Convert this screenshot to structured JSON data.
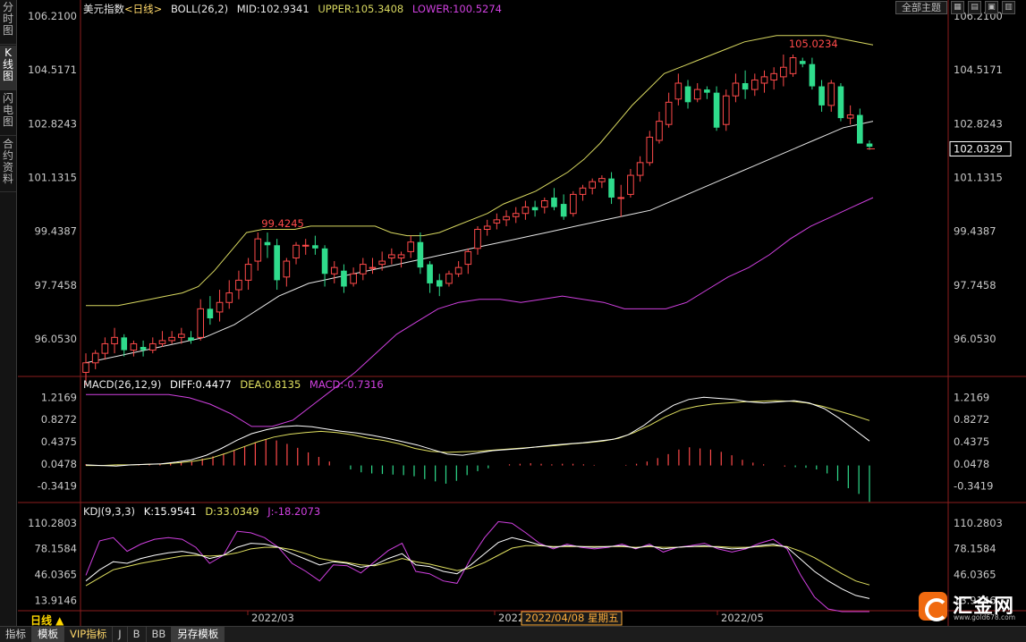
{
  "left_tabs": [
    "分时图",
    "K线图",
    "闪电图",
    "合约资料"
  ],
  "header": {
    "boll": {
      "name": "美元指数",
      "period": "<日线>",
      "params": "BOLL(26,2)",
      "mid": "MID:102.9341",
      "upper": "UPPER:105.3408",
      "lower": "LOWER:100.5274"
    },
    "theme_button": "全部主题",
    "window_buttons": [
      "▦",
      "▤",
      "▣",
      "▥"
    ]
  },
  "price_axis": {
    "ticks": [
      "106.2100",
      "104.5171",
      "102.8243",
      "101.1315",
      "99.4387",
      "97.7458",
      "96.0530"
    ],
    "current_price": "102.0329"
  },
  "annotations": {
    "high_label": "105.0234",
    "low_label": "99.4245"
  },
  "macd": {
    "title": "MACD(26,12,9)",
    "diff": "DIFF:0.4477",
    "dea": "DEA:0.8135",
    "macd": "MACD:-0.7316",
    "ticks": [
      "1.2169",
      "0.8272",
      "0.4375",
      "0.0478",
      "-0.3419"
    ]
  },
  "kdj": {
    "title": "KDJ(9,3,3)",
    "k": "K:15.9541",
    "d": "D:33.0349",
    "j": "J:-18.2073",
    "ticks": [
      "110.2803",
      "78.1584",
      "46.0365",
      "13.9146"
    ]
  },
  "date_axis": {
    "labels": [
      "2022/03",
      "2022/04",
      "2022/05"
    ],
    "cursor_date": "2022/04/08 星期五"
  },
  "period_label": "日线 ▲",
  "bottom_tabs": [
    "指标",
    "模板",
    "VIP指标",
    "J",
    "B",
    "BB",
    "另存模板"
  ],
  "bottom_tab_active": "模板",
  "logo": {
    "text": "汇金网",
    "url": "www.gold678.com"
  },
  "colors": {
    "up": "#ff4a4a",
    "down": "#2fdc8c",
    "mid": "#e6e6e6",
    "upper": "#d8d860",
    "lower": "#d040e0",
    "axis": "#8c1e1e",
    "diff": "#ffffff",
    "dea": "#e0e060",
    "k": "#ffffff",
    "d": "#e0e060",
    "j": "#d040e0"
  },
  "chart_data": {
    "type": "candlestick",
    "price_range": [
      94.9,
      106.21
    ],
    "candles": [
      [
        95.0,
        95.6,
        94.6,
        95.3
      ],
      [
        95.3,
        95.7,
        95.1,
        95.6
      ],
      [
        95.6,
        96.1,
        95.4,
        95.9
      ],
      [
        95.9,
        96.4,
        95.6,
        96.1
      ],
      [
        96.1,
        96.2,
        95.5,
        95.7
      ],
      [
        95.7,
        96.0,
        95.5,
        95.9
      ],
      [
        95.8,
        96.0,
        95.5,
        95.7
      ],
      [
        95.7,
        96.1,
        95.6,
        95.9
      ],
      [
        95.9,
        96.3,
        95.8,
        96.0
      ],
      [
        96.0,
        96.3,
        95.9,
        96.1
      ],
      [
        96.1,
        96.4,
        95.9,
        96.2
      ],
      [
        96.1,
        96.3,
        95.9,
        96.0
      ],
      [
        96.1,
        97.3,
        96.0,
        97.0
      ],
      [
        97.0,
        97.4,
        96.5,
        96.7
      ],
      [
        96.9,
        97.6,
        96.6,
        97.2
      ],
      [
        97.2,
        97.9,
        97.0,
        97.5
      ],
      [
        97.6,
        98.2,
        97.3,
        97.9
      ],
      [
        97.9,
        98.6,
        97.6,
        98.4
      ],
      [
        98.5,
        99.4,
        98.2,
        99.2
      ],
      [
        99.1,
        99.4,
        98.6,
        99.0
      ],
      [
        99.0,
        99.2,
        97.6,
        97.9
      ],
      [
        98.0,
        98.6,
        97.7,
        98.5
      ],
      [
        98.6,
        99.1,
        98.4,
        99.0
      ],
      [
        99.0,
        99.2,
        98.7,
        99.0
      ],
      [
        99.0,
        99.3,
        98.7,
        98.9
      ],
      [
        98.9,
        99.0,
        97.7,
        98.1
      ],
      [
        98.1,
        98.5,
        97.8,
        98.3
      ],
      [
        98.2,
        98.4,
        97.5,
        97.7
      ],
      [
        97.8,
        98.3,
        97.7,
        98.1
      ],
      [
        98.1,
        98.6,
        97.9,
        98.4
      ],
      [
        98.3,
        98.6,
        98.1,
        98.3
      ],
      [
        98.4,
        98.8,
        98.2,
        98.5
      ],
      [
        98.6,
        98.9,
        98.4,
        98.7
      ],
      [
        98.6,
        98.8,
        98.3,
        98.7
      ],
      [
        98.8,
        99.3,
        98.6,
        99.1
      ],
      [
        99.1,
        99.4,
        98.1,
        98.3
      ],
      [
        98.4,
        98.5,
        97.5,
        97.8
      ],
      [
        97.9,
        98.1,
        97.4,
        97.7
      ],
      [
        97.8,
        98.2,
        97.7,
        98.1
      ],
      [
        98.1,
        98.5,
        98.0,
        98.3
      ],
      [
        98.4,
        98.9,
        98.1,
        98.8
      ],
      [
        98.9,
        99.6,
        98.7,
        99.5
      ],
      [
        99.5,
        99.8,
        99.3,
        99.6
      ],
      [
        99.7,
        100.0,
        99.5,
        99.8
      ],
      [
        99.8,
        100.1,
        99.6,
        99.9
      ],
      [
        99.9,
        100.2,
        99.7,
        100.0
      ],
      [
        100.0,
        100.4,
        99.8,
        100.2
      ],
      [
        100.2,
        100.4,
        99.9,
        100.1
      ],
      [
        100.2,
        100.5,
        100.0,
        100.4
      ],
      [
        100.5,
        100.8,
        100.1,
        100.2
      ],
      [
        100.3,
        100.6,
        99.8,
        99.9
      ],
      [
        100.0,
        100.7,
        99.9,
        100.6
      ],
      [
        100.6,
        100.9,
        100.4,
        100.8
      ],
      [
        100.8,
        101.1,
        100.6,
        101.0
      ],
      [
        101.0,
        101.2,
        100.8,
        101.1
      ],
      [
        101.1,
        101.3,
        100.3,
        100.5
      ],
      [
        100.5,
        100.9,
        99.9,
        100.5
      ],
      [
        100.6,
        101.4,
        100.5,
        101.2
      ],
      [
        101.2,
        101.8,
        101.0,
        101.6
      ],
      [
        101.6,
        102.6,
        101.5,
        102.4
      ],
      [
        102.3,
        103.2,
        102.2,
        102.9
      ],
      [
        102.8,
        103.8,
        102.7,
        103.5
      ],
      [
        103.6,
        104.4,
        103.4,
        104.1
      ],
      [
        104.0,
        104.2,
        103.3,
        103.5
      ],
      [
        103.6,
        104.1,
        103.5,
        103.9
      ],
      [
        103.9,
        104.0,
        103.6,
        103.8
      ],
      [
        103.8,
        104.0,
        102.6,
        102.7
      ],
      [
        102.8,
        103.9,
        102.6,
        103.7
      ],
      [
        103.7,
        104.4,
        103.5,
        104.1
      ],
      [
        104.1,
        104.5,
        103.6,
        103.9
      ],
      [
        103.9,
        104.4,
        103.7,
        104.2
      ],
      [
        104.1,
        104.5,
        103.8,
        104.3
      ],
      [
        104.2,
        104.6,
        103.9,
        104.4
      ],
      [
        104.3,
        105.0,
        104.0,
        104.6
      ],
      [
        104.4,
        105.0,
        104.3,
        104.9
      ],
      [
        104.8,
        104.9,
        104.6,
        104.7
      ],
      [
        104.7,
        104.9,
        103.9,
        104.0
      ],
      [
        104.0,
        104.2,
        103.2,
        103.4
      ],
      [
        103.4,
        104.2,
        103.2,
        104.1
      ],
      [
        104.0,
        104.1,
        102.9,
        103.0
      ],
      [
        103.0,
        103.4,
        102.8,
        103.1
      ],
      [
        103.1,
        103.3,
        102.2,
        102.2
      ],
      [
        102.2,
        102.3,
        102.0,
        102.1
      ]
    ],
    "mid": [
      95.3,
      95.4,
      95.5,
      95.6,
      95.7,
      95.8,
      95.9,
      96.0,
      96.1,
      96.3,
      96.5,
      96.8,
      97.1,
      97.4,
      97.6,
      97.8,
      97.9,
      98.0,
      98.1,
      98.2,
      98.3,
      98.4,
      98.5,
      98.6,
      98.7,
      98.8,
      98.9,
      99.0,
      99.1,
      99.2,
      99.3,
      99.4,
      99.5,
      99.6,
      99.7,
      99.8,
      99.9,
      100.0,
      100.1,
      100.3,
      100.5,
      100.7,
      100.9,
      101.1,
      101.3,
      101.5,
      101.7,
      101.9,
      102.1,
      102.3,
      102.5,
      102.7,
      102.8,
      102.9
    ],
    "upper": [
      97.1,
      97.1,
      97.1,
      97.2,
      97.3,
      97.4,
      97.5,
      97.7,
      98.2,
      98.8,
      99.4,
      99.5,
      99.5,
      99.5,
      99.6,
      99.6,
      99.6,
      99.6,
      99.6,
      99.4,
      99.3,
      99.3,
      99.4,
      99.6,
      99.8,
      100.0,
      100.3,
      100.5,
      100.7,
      101.0,
      101.3,
      101.7,
      102.2,
      102.8,
      103.4,
      103.9,
      104.4,
      104.6,
      104.8,
      105.0,
      105.2,
      105.4,
      105.5,
      105.6,
      105.6,
      105.6,
      105.6,
      105.5,
      105.4,
      105.3
    ],
    "lower": [
      94.3,
      94.3,
      94.3,
      94.3,
      94.3,
      94.2,
      94.0,
      93.7,
      93.3,
      93.3,
      93.5,
      94.0,
      94.5,
      95.0,
      95.6,
      96.2,
      96.6,
      97.0,
      97.2,
      97.3,
      97.3,
      97.2,
      97.3,
      97.4,
      97.3,
      97.2,
      97.0,
      97.0,
      97.0,
      97.2,
      97.6,
      98.0,
      98.3,
      98.7,
      99.2,
      99.6,
      99.9,
      100.2,
      100.5
    ],
    "macd_range": [
      -0.6,
      1.35
    ],
    "macd_bars": [
      0.04,
      0.03,
      0.02,
      0.03,
      0.02,
      0.03,
      0.04,
      0.05,
      0.06,
      0.08,
      0.1,
      0.14,
      0.18,
      0.23,
      0.29,
      0.36,
      0.43,
      0.48,
      0.46,
      0.4,
      0.33,
      0.25,
      0.17,
      0.09,
      0.02,
      -0.05,
      -0.1,
      -0.12,
      -0.13,
      -0.14,
      -0.15,
      -0.17,
      -0.22,
      -0.26,
      -0.3,
      -0.25,
      -0.15,
      -0.08,
      -0.03,
      0.02,
      0.04,
      0.05,
      0.06,
      0.05,
      0.04,
      0.05,
      0.05,
      0.04,
      0.03,
      0.02,
      0.02,
      0.03,
      0.05,
      0.09,
      0.15,
      0.22,
      0.3,
      0.34,
      0.32,
      0.3,
      0.26,
      0.2,
      0.12,
      0.07,
      0.04,
      0.02,
      0.0,
      -0.01,
      -0.02,
      -0.05,
      -0.12,
      -0.25,
      -0.38,
      -0.48,
      -0.62
    ],
    "diff": [
      0.03,
      0.02,
      0.01,
      0.03,
      0.04,
      0.05,
      0.08,
      0.12,
      0.2,
      0.32,
      0.46,
      0.58,
      0.65,
      0.7,
      0.72,
      0.7,
      0.66,
      0.62,
      0.59,
      0.55,
      0.5,
      0.44,
      0.38,
      0.3,
      0.22,
      0.2,
      0.24,
      0.28,
      0.3,
      0.32,
      0.35,
      0.38,
      0.4,
      0.42,
      0.45,
      0.48,
      0.56,
      0.72,
      0.92,
      1.08,
      1.18,
      1.22,
      1.2,
      1.18,
      1.14,
      1.12,
      1.14,
      1.16,
      1.12,
      1.02,
      0.85,
      0.65,
      0.45
    ],
    "dea": [
      0.02,
      0.02,
      0.03,
      0.03,
      0.04,
      0.05,
      0.07,
      0.1,
      0.15,
      0.24,
      0.34,
      0.44,
      0.52,
      0.57,
      0.6,
      0.62,
      0.6,
      0.56,
      0.5,
      0.46,
      0.4,
      0.32,
      0.27,
      0.25,
      0.26,
      0.27,
      0.29,
      0.31,
      0.33,
      0.35,
      0.37,
      0.4,
      0.42,
      0.45,
      0.5,
      0.6,
      0.73,
      0.88,
      1.0,
      1.06,
      1.1,
      1.12,
      1.14,
      1.15,
      1.16,
      1.15,
      1.12,
      1.06,
      0.98,
      0.9,
      0.81
    ],
    "kdj_range": [
      2,
      118
    ],
    "k": [
      38,
      52,
      62,
      60,
      66,
      70,
      73,
      75,
      72,
      66,
      70,
      80,
      85,
      84,
      80,
      72,
      65,
      58,
      62,
      60,
      55,
      58,
      66,
      72,
      58,
      56,
      50,
      47,
      58,
      72,
      86,
      92,
      88,
      83,
      80,
      82,
      81,
      80,
      81,
      82,
      79,
      82,
      78,
      80,
      81,
      82,
      80,
      78,
      79,
      82,
      84,
      80,
      65,
      50,
      38,
      28,
      20,
      16
    ],
    "d": [
      32,
      42,
      52,
      56,
      60,
      63,
      66,
      69,
      70,
      69,
      70,
      73,
      78,
      80,
      80,
      77,
      72,
      66,
      63,
      61,
      58,
      57,
      61,
      66,
      62,
      59,
      55,
      51,
      54,
      61,
      70,
      79,
      82,
      82,
      81,
      81,
      81,
      81,
      81,
      81,
      80,
      81,
      80,
      80,
      81,
      81,
      81,
      80,
      80,
      81,
      82,
      81,
      75,
      67,
      57,
      47,
      38,
      33
    ],
    "j": [
      45,
      88,
      92,
      75,
      84,
      90,
      92,
      90,
      80,
      60,
      70,
      100,
      98,
      92,
      80,
      60,
      50,
      38,
      58,
      57,
      48,
      62,
      76,
      85,
      50,
      47,
      38,
      35,
      66,
      92,
      112,
      110,
      98,
      85,
      78,
      84,
      80,
      78,
      80,
      84,
      78,
      84,
      74,
      80,
      82,
      85,
      78,
      74,
      78,
      85,
      90,
      78,
      45,
      18,
      3,
      -10,
      -16,
      -18
    ]
  }
}
